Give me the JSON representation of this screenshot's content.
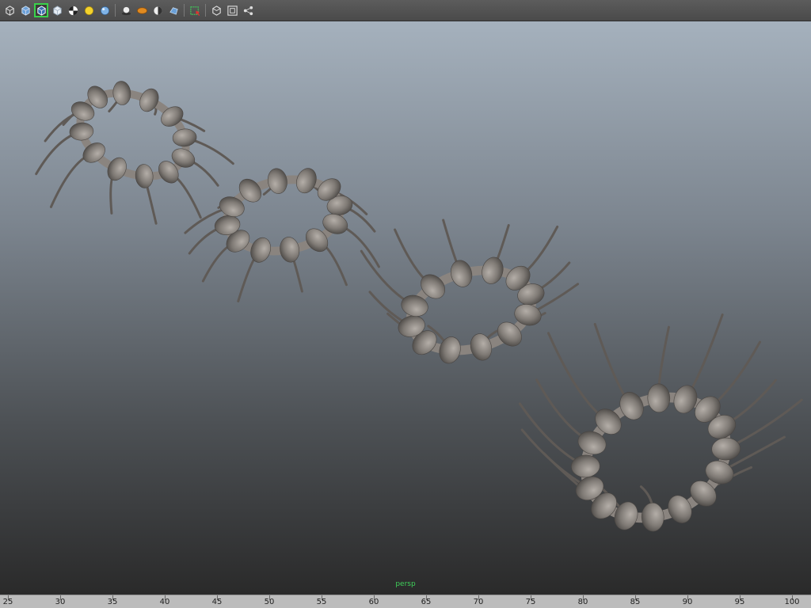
{
  "toolbar": {
    "buttons": [
      {
        "name": "wireframe-cube-icon",
        "active": false
      },
      {
        "name": "smooth-shade-cube-icon",
        "active": false
      },
      {
        "name": "wireframe-on-shaded-icon",
        "active": true
      },
      {
        "name": "default-material-icon",
        "active": false
      },
      {
        "name": "checker-texture-icon",
        "active": false
      },
      {
        "name": "lights-sun-icon",
        "active": false
      },
      {
        "name": "sphere-shade-icon",
        "active": false
      },
      {
        "name": "separator",
        "active": false
      },
      {
        "name": "shadows-icon",
        "active": false
      },
      {
        "name": "ambient-occlusion-icon",
        "active": false
      },
      {
        "name": "half-shade-icon",
        "active": false
      },
      {
        "name": "motion-blur-icon",
        "active": false
      },
      {
        "name": "separator",
        "active": false
      },
      {
        "name": "isolate-select-icon",
        "active": false
      },
      {
        "name": "separator",
        "active": false
      },
      {
        "name": "xray-cube-icon",
        "active": false
      },
      {
        "name": "frame-all-icon",
        "active": false
      },
      {
        "name": "share-node-icon",
        "active": false
      }
    ]
  },
  "viewport": {
    "camera_label": "persp",
    "label_color": "#3fd05a",
    "object_color": "#8a847f"
  },
  "timeline": {
    "labels": [
      "25",
      "30",
      "35",
      "40",
      "45",
      "50",
      "55",
      "60",
      "65",
      "70",
      "75",
      "80",
      "85",
      "90",
      "95",
      "100"
    ]
  }
}
